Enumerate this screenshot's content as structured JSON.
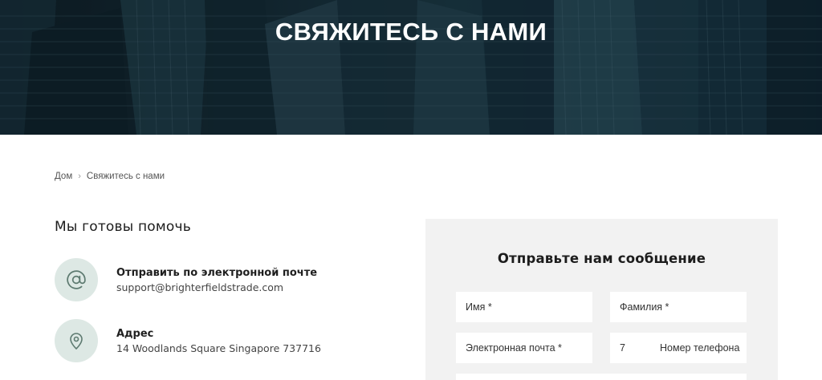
{
  "hero": {
    "title": "СВЯЖИТЕСЬ С НАМИ"
  },
  "breadcrumb": {
    "home": "Дом",
    "separator": "›",
    "current": "Свяжитесь с нами"
  },
  "help": {
    "title": "Мы готовы помочь",
    "items": [
      {
        "icon": "at-sign-icon",
        "label": "Отправить по электронной почте",
        "value": "support@brighterfieldstrade.com"
      },
      {
        "icon": "map-pin-icon",
        "label": "Адрес",
        "value": "14 Woodlands Square Singapore 737716"
      }
    ]
  },
  "form": {
    "title": "Отправьте нам сообщение",
    "first_name_placeholder": "Имя *",
    "last_name_placeholder": "Фамилия *",
    "email_placeholder": "Электронная почта *",
    "phone_code": "7",
    "phone_placeholder": "Номер телефона"
  },
  "colors": {
    "icon_circle_bg": "#dde8e4",
    "icon_stroke": "#5d7a70",
    "form_bg": "#f2f2f2"
  }
}
